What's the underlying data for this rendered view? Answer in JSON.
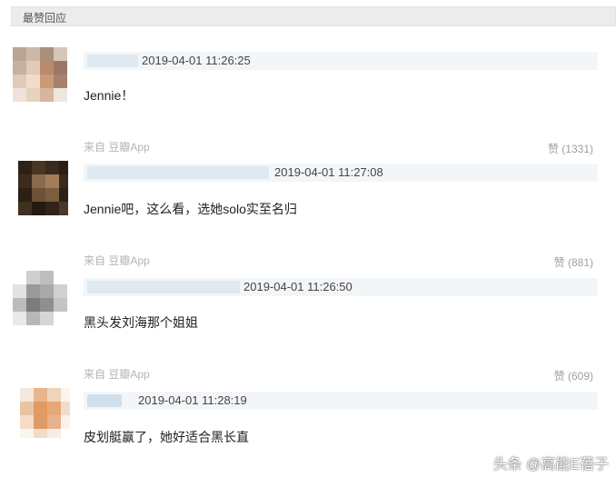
{
  "header": {
    "title": "最赞回应"
  },
  "comments": [
    {
      "time": "2019-04-01 11:26:25",
      "text": "Jennie！",
      "source": "来自 豆瓣App",
      "likes": "赞 (1331)"
    },
    {
      "time": "2019-04-01 11:27:08",
      "text": "Jennie吧，这么看，选她solo实至名归",
      "source": "来自 豆瓣App",
      "likes": "赞 (881)"
    },
    {
      "time": "2019-04-01 11:26:50",
      "text": "黑头发刘海那个姐姐",
      "source": "来自 豆瓣App",
      "likes": "赞 (609)"
    },
    {
      "time": "2019-04-01 11:28:19",
      "text": "皮划艇赢了，她好适合黑长直"
    }
  ],
  "watermark": "头条 @高能E蓓子",
  "icons": {
    "avatar": "blurred-avatar-image"
  }
}
